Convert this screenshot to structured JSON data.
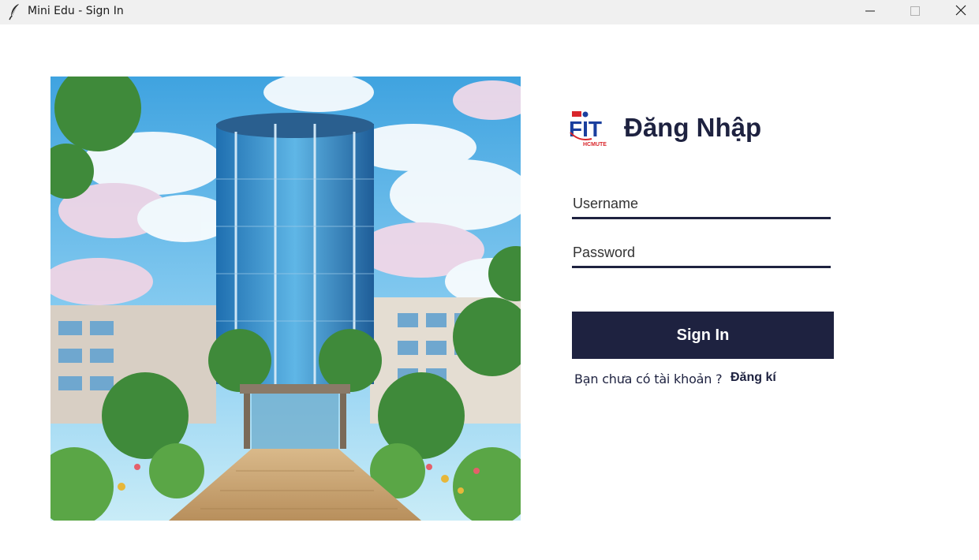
{
  "window": {
    "title": "Mini Edu - Sign In",
    "app_icon": "feather-icon",
    "controls": [
      "minimize-icon",
      "maximize-icon",
      "close-icon"
    ]
  },
  "illustration": {
    "description_icon": "campus-building-image"
  },
  "logo": {
    "text_main": "FIT",
    "text_sub": "HCMUTE"
  },
  "form": {
    "heading": "Đăng Nhập",
    "username_placeholder": "Username",
    "password_placeholder": "Password",
    "signin_label": "Sign In",
    "no_account_text": "Bạn chưa có tài khoản ?",
    "register_label": "Đăng kí"
  },
  "colors": {
    "primary": "#1e2240",
    "titlebar": "#f0f0f0",
    "background": "#ffffff"
  }
}
